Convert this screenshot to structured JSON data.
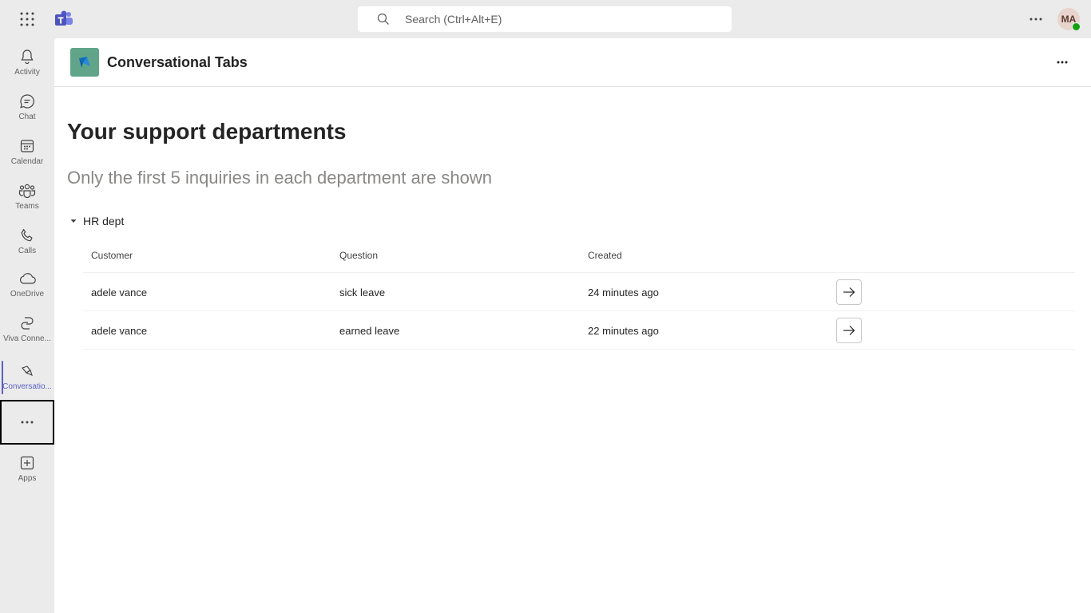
{
  "topbar": {
    "search_placeholder": "Search (Ctrl+Alt+E)",
    "avatar_initials": "MA",
    "presence_color": "#13a10e"
  },
  "rail": {
    "accent": "#5b5fc7",
    "items": [
      {
        "label": "Activity",
        "icon": "bell-icon"
      },
      {
        "label": "Chat",
        "icon": "chat-icon"
      },
      {
        "label": "Calendar",
        "icon": "calendar-icon"
      },
      {
        "label": "Teams",
        "icon": "teams-icon"
      },
      {
        "label": "Calls",
        "icon": "phone-icon"
      },
      {
        "label": "OneDrive",
        "icon": "cloud-icon"
      },
      {
        "label": "Viva Conne...",
        "icon": "viva-connections-icon"
      },
      {
        "label": "Conversatio...",
        "icon": "conversational-tabs-app-icon",
        "active": true
      }
    ],
    "apps_label": "Apps"
  },
  "app": {
    "title": "Conversational Tabs",
    "logo_color": "#60a58a"
  },
  "page": {
    "heading": "Your support departments",
    "subheading": "Only the first 5 inquiries in each department are shown"
  },
  "department": {
    "name": "HR dept",
    "columns": [
      "Customer",
      "Question",
      "Created"
    ],
    "rows": [
      {
        "customer": "adele vance",
        "question": "sick leave",
        "created": "24 minutes ago"
      },
      {
        "customer": "adele vance",
        "question": "earned leave",
        "created": "22 minutes ago"
      }
    ]
  }
}
